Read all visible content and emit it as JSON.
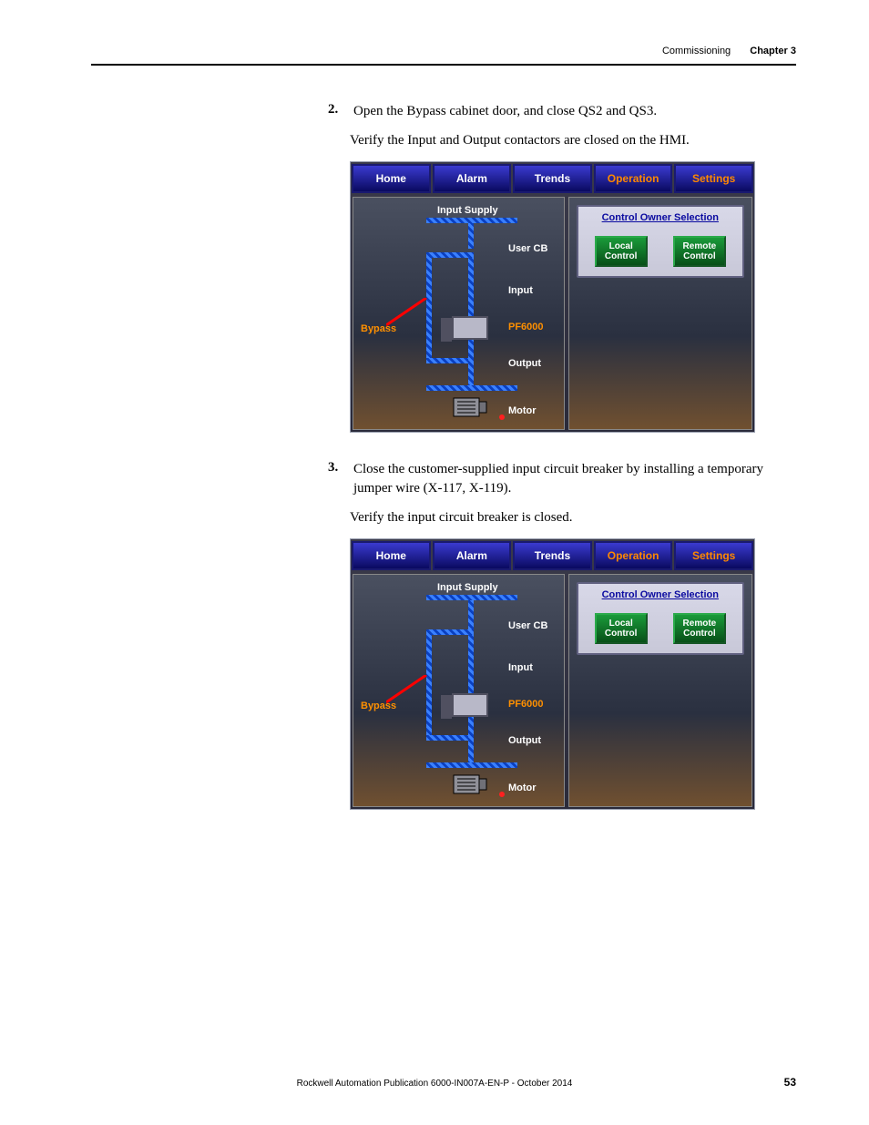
{
  "header": {
    "section": "Commissioning",
    "chapter": "Chapter 3"
  },
  "steps": {
    "s2": {
      "num": "2.",
      "text": "Open the Bypass cabinet door, and close QS2 and QS3.",
      "verify": "Verify the Input and Output contactors are closed on the HMI."
    },
    "s3": {
      "num": "3.",
      "text": "Close the customer-supplied input circuit breaker by installing a temporary jumper wire (X-117, X-119).",
      "verify": "Verify the input circuit breaker is closed."
    }
  },
  "hmi": {
    "tabs": {
      "home": "Home",
      "alarm": "Alarm",
      "trends": "Trends",
      "operation": "Operation",
      "settings": "Settings"
    },
    "diagram": {
      "input_supply": "Input Supply",
      "user_cb": "User CB",
      "input": "Input",
      "pf6000": "PF6000",
      "output": "Output",
      "motor": "Motor",
      "bypass": "Bypass"
    },
    "cos": {
      "title": "Control Owner Selection",
      "local1": "Local",
      "local2": "Control",
      "remote1": "Remote",
      "remote2": "Control"
    }
  },
  "footer": {
    "pub": "Rockwell Automation Publication 6000-IN007A-EN-P - October 2014",
    "page": "53"
  }
}
